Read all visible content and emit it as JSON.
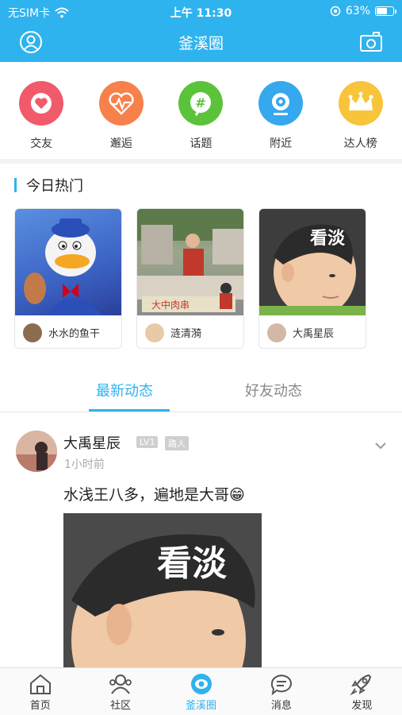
{
  "status": {
    "carrier": "无SIM卡",
    "time": "上午 11:30",
    "battery": "63%"
  },
  "header": {
    "title": "釜溪圈",
    "user_icon": "user-icon",
    "camera_icon": "camera-icon"
  },
  "quick": [
    {
      "label": "交友",
      "color": "#f05a6b",
      "icon": "heart-icon"
    },
    {
      "label": "邂逅",
      "color": "#f7804b",
      "icon": "pulse-heart-icon"
    },
    {
      "label": "话题",
      "color": "#5ac33a",
      "icon": "hashtag-icon"
    },
    {
      "label": "附近",
      "color": "#35a8ee",
      "icon": "location-camera-icon"
    },
    {
      "label": "达人榜",
      "color": "#f8c43a",
      "icon": "crown-icon"
    }
  ],
  "hot": {
    "title": "今日热门",
    "cards": [
      {
        "user": "水水的鱼干"
      },
      {
        "user": "涟清漪",
        "photo_text": "大中肉串"
      },
      {
        "user": "大禹星辰",
        "photo_text": "看淡"
      }
    ]
  },
  "tabs": {
    "latest": "最新动态",
    "friends": "好友动态"
  },
  "post": {
    "name": "大禹星辰",
    "level": "LV1",
    "rank": "路人",
    "time": "1小时前",
    "text": "水浅王八多，遍地是大哥😁",
    "photo_text": "看淡"
  },
  "bottom_nav": [
    {
      "label": "首页",
      "icon": "home-icon"
    },
    {
      "label": "社区",
      "icon": "community-icon"
    },
    {
      "label": "釜溪圈",
      "icon": "circle-eye-icon",
      "active": true
    },
    {
      "label": "消息",
      "icon": "message-icon"
    },
    {
      "label": "发现",
      "icon": "rocket-icon"
    }
  ],
  "colors": {
    "accent": "#2fb3ee"
  }
}
